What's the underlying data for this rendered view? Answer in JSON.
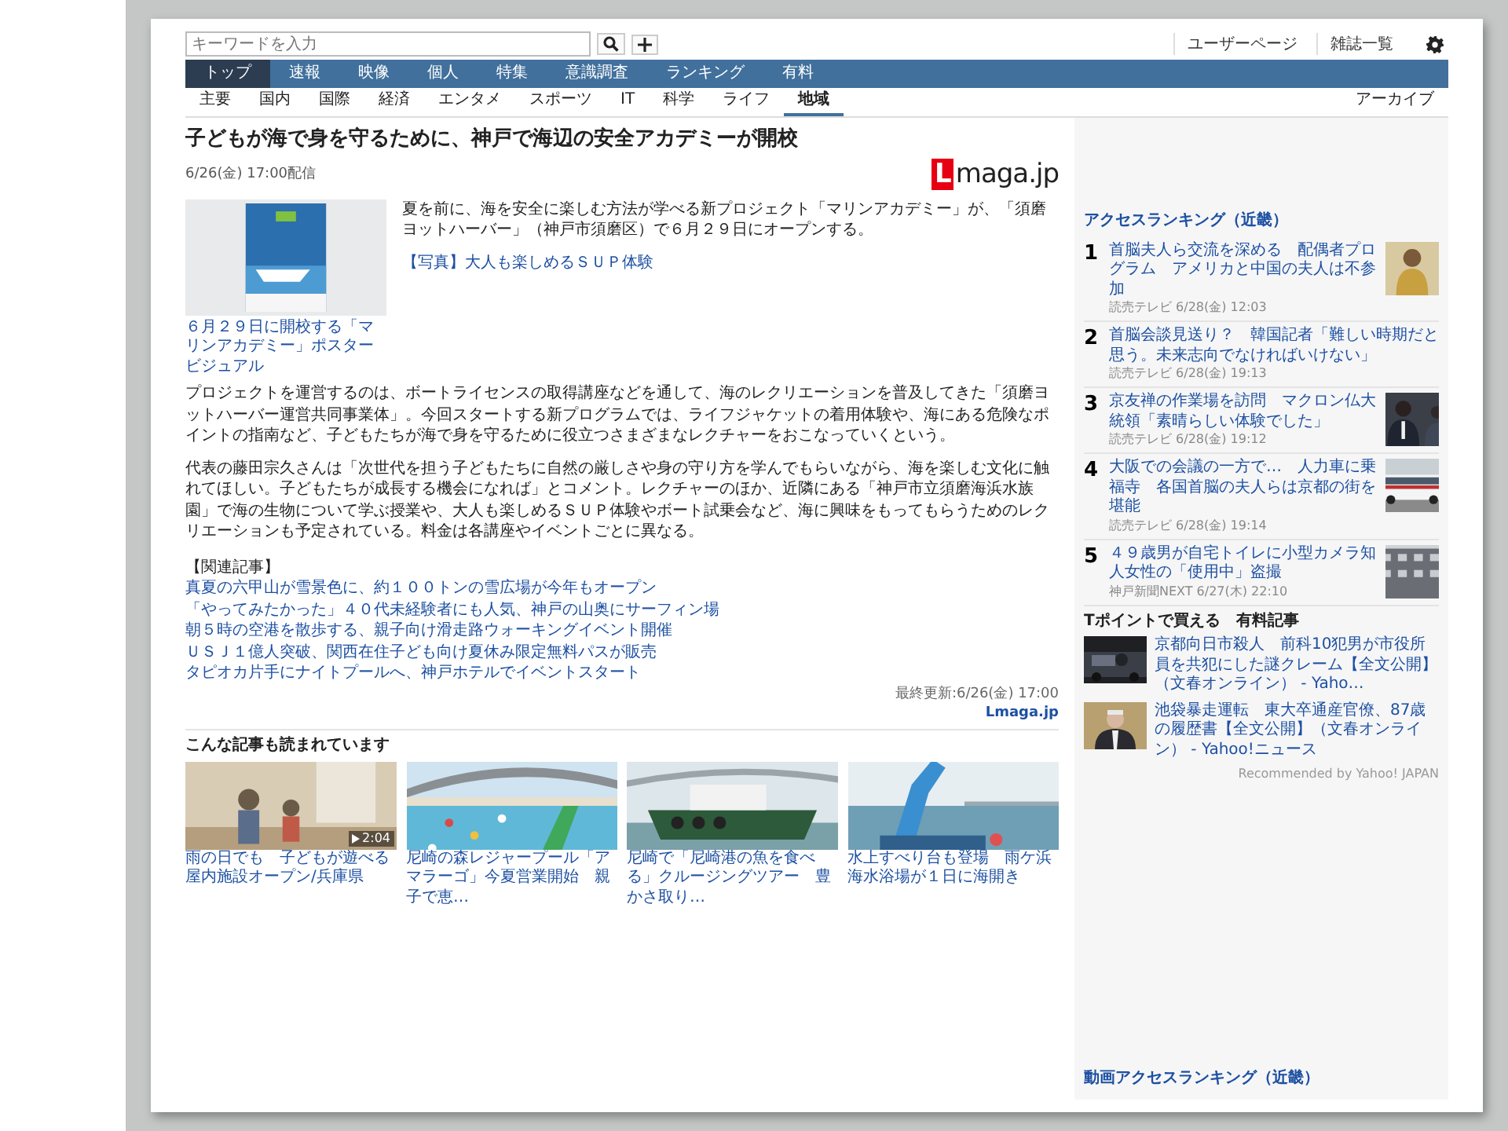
{
  "header": {
    "search": {
      "placeholder": "キーワードを入力"
    },
    "links": [
      "ユーザーページ",
      "雑誌一覧"
    ]
  },
  "nav": {
    "tabs": [
      {
        "label": "トップ",
        "selected": true
      },
      {
        "label": "速報",
        "selected": false
      },
      {
        "label": "映像",
        "selected": false
      },
      {
        "label": "個人",
        "selected": false
      },
      {
        "label": "特集",
        "selected": false
      },
      {
        "label": "意識調査",
        "selected": false
      },
      {
        "label": "ランキング",
        "selected": false
      },
      {
        "label": "有料",
        "selected": false
      }
    ]
  },
  "subnav": {
    "items": [
      {
        "label": "主要",
        "selected": false
      },
      {
        "label": "国内",
        "selected": false
      },
      {
        "label": "国際",
        "selected": false
      },
      {
        "label": "経済",
        "selected": false
      },
      {
        "label": "エンタメ",
        "selected": false
      },
      {
        "label": "スポーツ",
        "selected": false
      },
      {
        "label": "IT",
        "selected": false
      },
      {
        "label": "科学",
        "selected": false
      },
      {
        "label": "ライフ",
        "selected": false
      },
      {
        "label": "地域",
        "selected": true
      }
    ],
    "archive": "アーカイブ"
  },
  "article": {
    "title": "子どもが海で身を守るために、神戸で海辺の安全アカデミーが開校",
    "date": "6/26(金) 17:00配信",
    "logo": {
      "mark": "L",
      "text": "maga.jp"
    },
    "figure": {
      "kind": "picture",
      "caption": "６月２９日に開校する「マリンアカデミー」ポスタービジュアル"
    },
    "body": [
      {
        "kind": "text",
        "text": "夏を前に、海を安全に楽しむ方法が学べる新プロジェクト「マリンアカデミー」が、「須磨ヨットハーバー」（神戸市須磨区）で６月２９日にオープンする。"
      },
      {
        "kind": "link",
        "text": "【写真】大人も楽しめるＳＵＰ体験"
      },
      {
        "kind": "text",
        "text": "プロジェクトを運営するのは、ボートライセンスの取得講座などを通して、海のレクリエーションを普及してきた「須磨ヨットハーバー運営共同事業体」。今回スタートする新プログラムでは、ライフジャケットの着用体験や、海にある危険なポイントの指南など、子どもたちが海で身を守るために役立つさまざまなレクチャーをおこなっていくという。"
      },
      {
        "kind": "text",
        "text": "代表の藤田宗久さんは「次世代を担う子どもたちに自然の厳しさや身の守り方を学んでもらいながら、海を楽しむ文化に触れてほしい。子どもたちが成長する機会になれば」とコメント。レクチャーのほか、近隣にある「神戸市立須磨海浜水族園」で海の生物について学ぶ授業や、大人も楽しめるＳＵＰ体験やボート試乗会など、海に興味をもってもらうためのレクリエーションも予定されている。料金は各講座やイベントごとに異なる。"
      }
    ],
    "related": {
      "heading": "【関連記事】",
      "links": [
        "真夏の六甲山が雪景色に、約１００トンの雪広場が今年もオープン",
        "「やってみたかった」４０代未経験者にも人気、神戸の山奥にサーフィン場",
        "朝５時の空港を散歩する、親子向け滑走路ウォーキングイベント開催",
        "ＵＳＪ１億人突破、関西在住子ども向け夏休み限定無料パスが販売",
        "タピオカ片手にナイトプールへ、神戸ホテルでイベントスタート"
      ]
    },
    "updated": "最終更新:6/26(金) 17:00",
    "source": "Lmaga.jp"
  },
  "recommended": {
    "title": "こんな記事も読まれています",
    "cards": [
      {
        "title": "雨の日でも　子どもが遊べる屋内施設オープン/兵庫県",
        "duration": "2:04"
      },
      {
        "title": "尼崎の森レジャープール「アマラーゴ」今夏営業開始　親子で恵…"
      },
      {
        "title": "尼崎で「尼崎港の魚を食べる」クルージングツアー　豊かさ取り…"
      },
      {
        "title": "水上すべり台も登場　雨ケ浜海水浴場が１日に海開き"
      }
    ]
  },
  "sidebar": {
    "ranking": {
      "title": "アクセスランキング（近畿）",
      "items": [
        {
          "rank": "1",
          "title": "首脳夫人ら交流を深める　配偶者プログラム　アメリカと中国の夫人は不参加",
          "meta": "読売テレビ 6/28(金) 12:03"
        },
        {
          "rank": "2",
          "title": "首脳会談見送り？　韓国記者「難しい時期だと思う。未来志向でなければいけない」",
          "meta": "読売テレビ 6/28(金) 19:13"
        },
        {
          "rank": "3",
          "title": "京友禅の作業場を訪問　マクロン仏大統領「素晴らしい体験でした」",
          "meta": "読売テレビ 6/28(金) 19:12"
        },
        {
          "rank": "4",
          "title": "大阪での会議の一方で…　人力車に乗福寺　各国首脳の夫人らは京都の街を堪能",
          "meta": "読売テレビ 6/28(金) 19:14"
        },
        {
          "rank": "5",
          "title": "４９歳男が自宅トイレに小型カメラ知人女性の「使用中」盗撮",
          "meta": "神戸新聞NEXT 6/27(木) 22:10"
        }
      ]
    },
    "paid": {
      "title": "Tポイントで買える　有料記事",
      "items": [
        {
          "title": "京都向日市殺人　前科10犯男が市役所員を共犯にした謎クレーム【全文公開】（文春オンライン） - Yaho…"
        },
        {
          "title": "池袋暴走運転　東大卒通産官僚、87歳の履歴書【全文公開】（文春オンライン） - Yahoo!ニュース"
        }
      ],
      "credit": "Recommended by Yahoo! JAPAN"
    },
    "video_ranking_title": "動画アクセスランキング（近畿）"
  }
}
